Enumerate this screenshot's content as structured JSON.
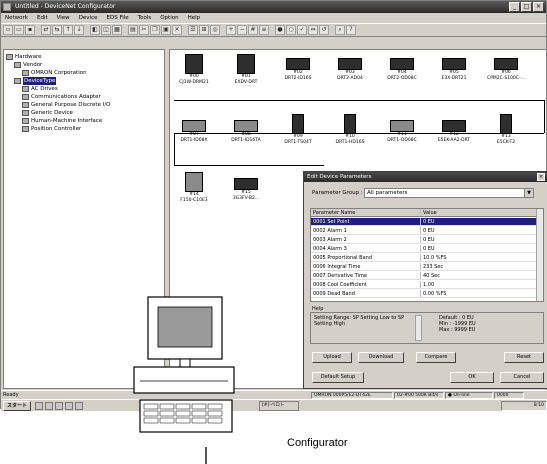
{
  "window": {
    "title": "Untitled - DeviceNet Configurator",
    "controls": [
      "_",
      "□",
      "×"
    ]
  },
  "menu": [
    "Network",
    "Edit",
    "View",
    "Device",
    "EDS File",
    "Tools",
    "Option",
    "Help"
  ],
  "tree": {
    "items": [
      {
        "label": "Hardware",
        "level": 0,
        "selected": false
      },
      {
        "label": "Vendor",
        "level": 1,
        "selected": false
      },
      {
        "label": "OMRON Corporation",
        "level": 2,
        "selected": false
      },
      {
        "label": "DeviceType",
        "level": 1,
        "selected": true
      },
      {
        "label": "AC Drives",
        "level": 2,
        "selected": false
      },
      {
        "label": "Communications Adapter",
        "level": 2,
        "selected": false
      },
      {
        "label": "General Purpose Discrete I/O",
        "level": 2,
        "selected": false
      },
      {
        "label": "Generic Device",
        "level": 2,
        "selected": false
      },
      {
        "label": "Human-Machine Interface",
        "level": 2,
        "selected": false
      },
      {
        "label": "Position Controller",
        "level": 2,
        "selected": false
      }
    ]
  },
  "devices": [
    {
      "addr": "#00",
      "name": "CJ1W-DRM21",
      "kind": "big",
      "shade": "dark"
    },
    {
      "addr": "#01",
      "name": "EXDV-DRT",
      "kind": "big",
      "shade": "dark"
    },
    {
      "addr": "#02",
      "name": "DRT2-ID16S",
      "kind": "small",
      "shade": "dark"
    },
    {
      "addr": "#03",
      "name": "DRT2-AD04",
      "kind": "small",
      "shade": "dark"
    },
    {
      "addr": "#04",
      "name": "DRT2-OD08C",
      "kind": "small",
      "shade": "dark"
    },
    {
      "addr": "#05",
      "name": "E3X-DRT21",
      "kind": "small",
      "shade": "dark"
    },
    {
      "addr": "#06",
      "name": "CPM2C-S100C-...",
      "kind": "small",
      "shade": "dark"
    },
    {
      "addr": "#07",
      "name": "DRT1-ID08X",
      "kind": "small",
      "shade": "light"
    },
    {
      "addr": "#08",
      "name": "DRT1-ID16TA",
      "kind": "small",
      "shade": "light"
    },
    {
      "addr": "#09",
      "name": "DRT1-TS04T",
      "kind": "tiny",
      "shade": "dark"
    },
    {
      "addr": "#10",
      "name": "DRT1-HD16S",
      "kind": "tiny",
      "shade": "dark"
    },
    {
      "addr": "#11",
      "name": "DRT1-OD08C",
      "kind": "small",
      "shade": "light"
    },
    {
      "addr": "#12",
      "name": "E5EK-AA2-DRT",
      "kind": "small",
      "shade": "dark"
    },
    {
      "addr": "#13",
      "name": "E5CK-T2",
      "kind": "tiny",
      "shade": "dark"
    },
    {
      "addr": "#14",
      "name": "F150-C10E3",
      "kind": "big",
      "shade": "light"
    },
    {
      "addr": "#15",
      "name": "3G3FV-B2...",
      "kind": "small",
      "shade": "dark"
    }
  ],
  "dialog": {
    "title": "Edit Device Parameters",
    "close": "×",
    "group_label": "Parameter Group :",
    "group_value": "All parameters",
    "col_name": "Parameter Name",
    "col_value": "Value",
    "rows": [
      {
        "name": "0001 Set Point",
        "value": "0 EU",
        "selected": true
      },
      {
        "name": "0002 Alarm 1",
        "value": "0 EU",
        "selected": false
      },
      {
        "name": "0003 Alarm 2",
        "value": "0 EU",
        "selected": false
      },
      {
        "name": "0004 Alarm 3",
        "value": "0 EU",
        "selected": false
      },
      {
        "name": "0005 Proportional Band",
        "value": "10.0 %FS",
        "selected": false
      },
      {
        "name": "0006 Integral Time",
        "value": "233 Sec",
        "selected": false
      },
      {
        "name": "0007 Derivative Time",
        "value": "40 Sec",
        "selected": false
      },
      {
        "name": "0008 Cool Coefficient",
        "value": "1.00",
        "selected": false
      },
      {
        "name": "0009 Dead Band",
        "value": "0.00 %FS",
        "selected": false
      }
    ],
    "help_label": "Help",
    "help_text": "Setting Range: SP Setting Low to SP Setting High",
    "help_default": "Default : 0 EU",
    "help_min": "Min : -1999 EU",
    "help_max": "Max : 9999 EU",
    "buttons": {
      "upload": "Upload",
      "download": "Download",
      "compare": "Compare",
      "reset": "Reset",
      "default_setup": "Default Setup",
      "ok": "OK",
      "cancel": "Cancel"
    }
  },
  "status": {
    "ready": "Ready",
    "device": "OMRON 000P5/E2-DT42E",
    "device2": "02-#00 500K Bit/s",
    "online": "On-line",
    "code": "0000"
  },
  "taskbar": {
    "start": "スタート",
    "item": "[#]-ベロト",
    "tray": "8:10"
  },
  "caption": "Configurator"
}
